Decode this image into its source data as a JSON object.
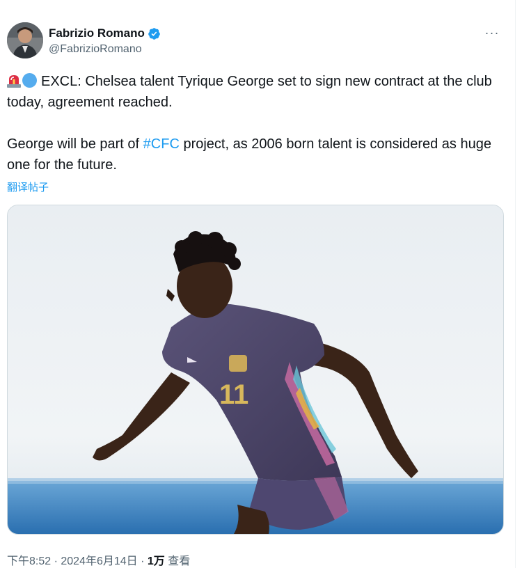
{
  "author": {
    "display_name": "Fabrizio Romano",
    "handle": "@FabrizioRomano",
    "verified": true,
    "avatar_icon": "avatar-photo"
  },
  "more_menu": {
    "label": "···"
  },
  "tweet": {
    "line1_lead_emojis": [
      "siren-emoji",
      "blue-circle-emoji"
    ],
    "paragraph1": "EXCL: Chelsea talent Tyrique George set to sign new contract at the club today, agreement reached.",
    "paragraph2_before": "George will be part of ",
    "hashtag": "#CFC",
    "paragraph2_after": " project, as 2006 born talent is considered as huge one for the future.",
    "translate_link": "翻译帖子"
  },
  "media": {
    "description_icon": "football-player-photo",
    "shirt_number": "11"
  },
  "footer": {
    "time": "下午8:52",
    "separator": " · ",
    "date": "2024年6月14日",
    "separator2": " · ",
    "views_count": "1万",
    "views_label": " 查看"
  },
  "colors": {
    "accent": "#1d9bf0",
    "text": "#0f1419",
    "secondary": "#536471",
    "border": "#cfd9de"
  }
}
